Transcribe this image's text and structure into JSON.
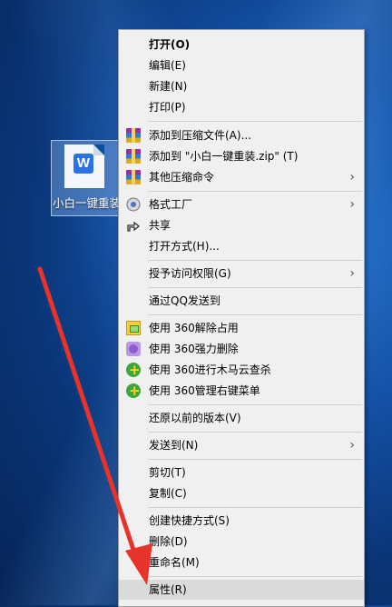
{
  "desktop": {
    "file_name": "小白一键重装",
    "file_icon": "wps-doc-icon"
  },
  "menu": {
    "items": [
      {
        "label": "打开(O)"
      },
      {
        "label": "编辑(E)"
      },
      {
        "label": "新建(N)"
      },
      {
        "label": "打印(P)"
      },
      {
        "label": "添加到压缩文件(A)..."
      },
      {
        "label": "添加到 \"小白一键重装.zip\" (T)"
      },
      {
        "label": "其他压缩命令"
      },
      {
        "label": "格式工厂"
      },
      {
        "label": "共享"
      },
      {
        "label": "打开方式(H)..."
      },
      {
        "label": "授予访问权限(G)"
      },
      {
        "label": "通过QQ发送到"
      },
      {
        "label": "使用 360解除占用"
      },
      {
        "label": "使用 360强力删除"
      },
      {
        "label": "使用 360进行木马云查杀"
      },
      {
        "label": "使用 360管理右键菜单"
      },
      {
        "label": "还原以前的版本(V)"
      },
      {
        "label": "发送到(N)"
      },
      {
        "label": "剪切(T)"
      },
      {
        "label": "复制(C)"
      },
      {
        "label": "创建快捷方式(S)"
      },
      {
        "label": "删除(D)"
      },
      {
        "label": "重命名(M)"
      },
      {
        "label": "属性(R)"
      }
    ],
    "submenu_arrow": "›"
  },
  "colors": {
    "highlight": "#cce0f7",
    "arrow": "#e8332a"
  }
}
